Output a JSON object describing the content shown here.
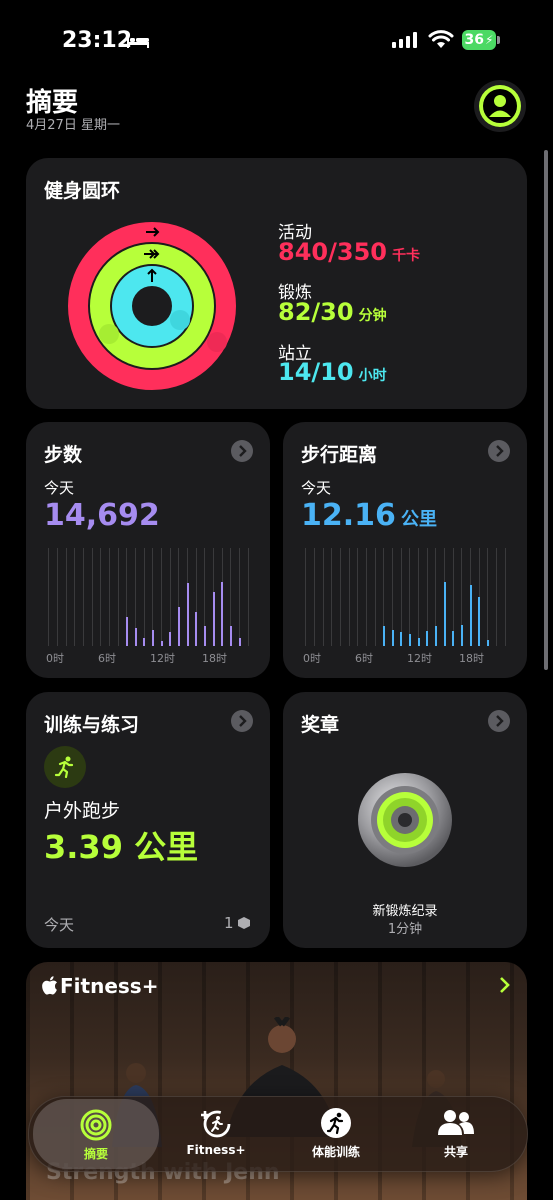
{
  "status_bar": {
    "time": "23:12",
    "battery": "36"
  },
  "header": {
    "title": "摘要",
    "date": "4月27日 星期一"
  },
  "rings_card": {
    "title": "健身圆环",
    "move": {
      "label": "活动",
      "value": "840/350",
      "unit": "千卡",
      "color": "#ff2f5b",
      "progress": 2.4
    },
    "exercise": {
      "label": "锻炼",
      "value": "82/30",
      "unit": "分钟",
      "color": "#b7ff3a",
      "progress": 2.73
    },
    "stand": {
      "label": "站立",
      "value": "14/10",
      "unit": "小时",
      "color": "#4de7ef",
      "progress": 1.4
    }
  },
  "steps_card": {
    "title": "步数",
    "period": "今天",
    "value": "14,692",
    "color": "#a68cf0",
    "ticks": [
      "0时",
      "6时",
      "12时",
      "18时"
    ]
  },
  "distance_card": {
    "title": "步行距离",
    "period": "今天",
    "value": "12.16",
    "unit": "公里",
    "color": "#4ab2f5",
    "ticks": [
      "0时",
      "6时",
      "12时",
      "18时"
    ]
  },
  "workouts_card": {
    "title": "训练与练习",
    "workout_name": "户外跑步",
    "workout_value": "3.39 公里",
    "period": "今天",
    "count": "1"
  },
  "awards_card": {
    "title": "奖章",
    "award_name": "新锻炼纪录",
    "award_value": "1分钟"
  },
  "fitness_plus": {
    "title": "Fitness+",
    "overlay_text": "Strength with Jenn"
  },
  "tab_bar": {
    "tabs": [
      {
        "label": "摘要",
        "icon": "rings-icon",
        "active": true
      },
      {
        "label": "Fitness+",
        "icon": "fitness-plus-icon",
        "active": false
      },
      {
        "label": "体能训练",
        "icon": "running-icon",
        "active": false
      },
      {
        "label": "共享",
        "icon": "sharing-icon",
        "active": false
      }
    ]
  }
}
